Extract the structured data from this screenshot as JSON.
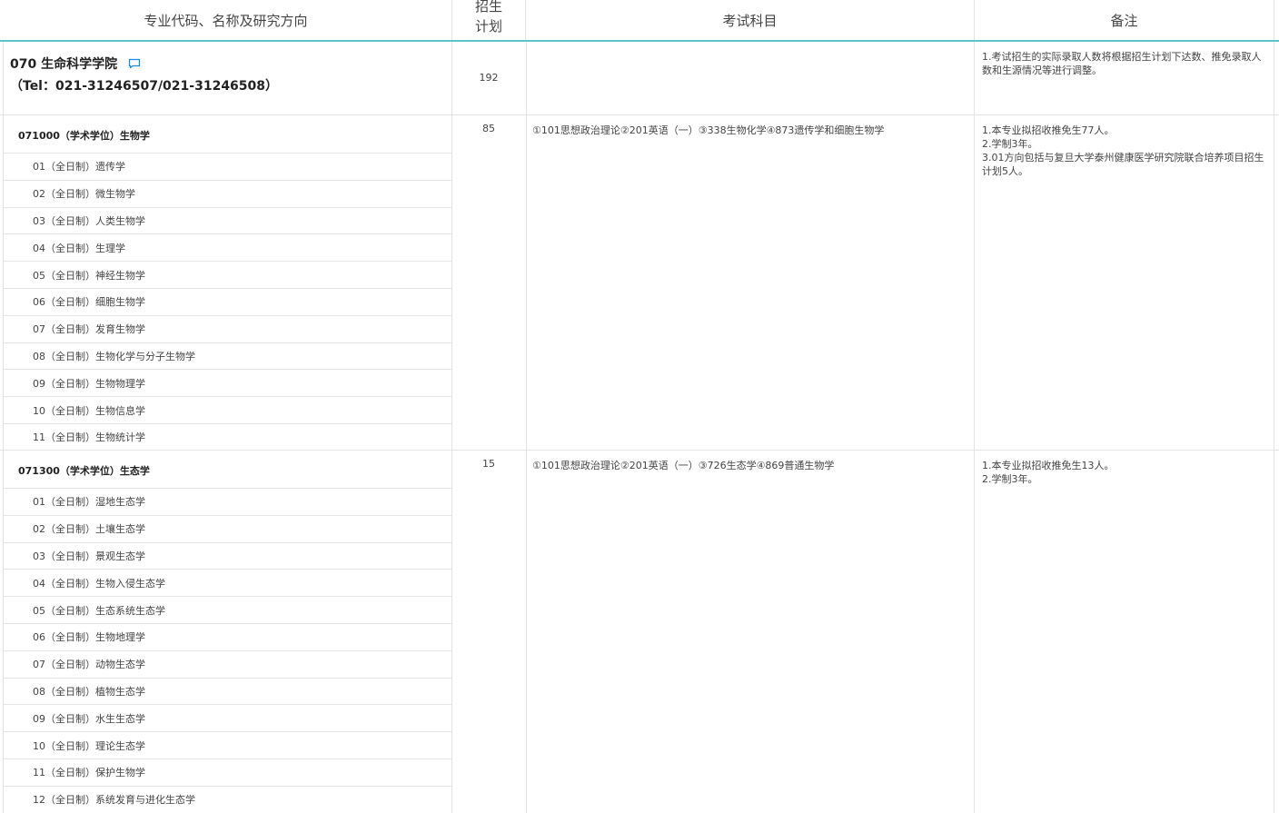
{
  "header": {
    "col_major": "专业代码、名称及研究方向",
    "col_plan_line1": "招生",
    "col_plan_line2": "计划",
    "col_exam": "考试科目",
    "col_note": "备注"
  },
  "college": {
    "name": "070 生命科学学院",
    "tel": "（Tel：021-31246507/021-31246508）",
    "plan": "192",
    "note": "1.考试招生的实际录取人数将根据招生计划下达数、推免录取人数和生源情况等进行调整。",
    "icons": [
      "comment-icon"
    ]
  },
  "majors": [
    {
      "title": "071000（学术学位）生物学",
      "plan": "85",
      "exam": "①101思想政治理论②201英语（一）③338生物化学④873遗传学和细胞生物学",
      "notes": [
        "1.本专业拟招收推免生77人。",
        "2.学制3年。",
        "3.01方向包括与复旦大学泰州健康医学研究院联合培养项目招生计划5人。"
      ],
      "directions": [
        "01（全日制）遗传学",
        "02（全日制）微生物学",
        "03（全日制）人类生物学",
        "04（全日制）生理学",
        "05（全日制）神经生物学",
        "06（全日制）细胞生物学",
        "07（全日制）发育生物学",
        "08（全日制）生物化学与分子生物学",
        "09（全日制）生物物理学",
        "10（全日制）生物信息学",
        "11（全日制）生物统计学"
      ]
    },
    {
      "title": "071300（学术学位）生态学",
      "plan": "15",
      "exam": "①101思想政治理论②201英语（一）③726生态学④869普通生物学",
      "notes": [
        "1.本专业拟招收推免生13人。",
        "2.学制3年。"
      ],
      "directions": [
        "01（全日制）湿地生态学",
        "02（全日制）土壤生态学",
        "03（全日制）景观生态学",
        "04（全日制）生物入侵生态学",
        "05（全日制）生态系统生态学",
        "06（全日制）生物地理学",
        "07（全日制）动物生态学",
        "08（全日制）植物生态学",
        "09（全日制）水生生态学",
        "10（全日制）理论生态学",
        "11（全日制）保护生物学",
        "12（全日制）系统发育与进化生态学"
      ]
    }
  ],
  "colors": {
    "accent": "#5cc5c8",
    "border": "#e4e4e4",
    "icon": "#1e88e5"
  }
}
